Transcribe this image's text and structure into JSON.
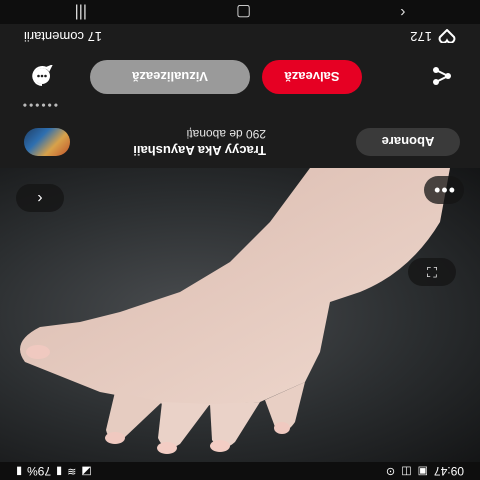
{
  "status_bar": {
    "time": "09:47",
    "battery": "79%",
    "left_icons": [
      "photo-icon",
      "gallery-icon",
      "download-icon"
    ],
    "right_icons": [
      "mute-icon",
      "wifi-icon",
      "signal-icon",
      "battery-icon"
    ]
  },
  "pin": {
    "author_name": "Tracyy Aka Aayushaii",
    "author_followers": "290 de abonați",
    "follow_label": "Abonare"
  },
  "actions": {
    "visit_label": "Vizualizează",
    "save_label": "Salvează"
  },
  "stats": {
    "likes": "172",
    "comments": "17 comentarii"
  },
  "nav": {
    "buttons": [
      "recent-apps",
      "home",
      "back"
    ]
  },
  "colors": {
    "accent": "#e60023",
    "secondary_button": "#9a9a9a",
    "background": "#1c1c1c"
  }
}
